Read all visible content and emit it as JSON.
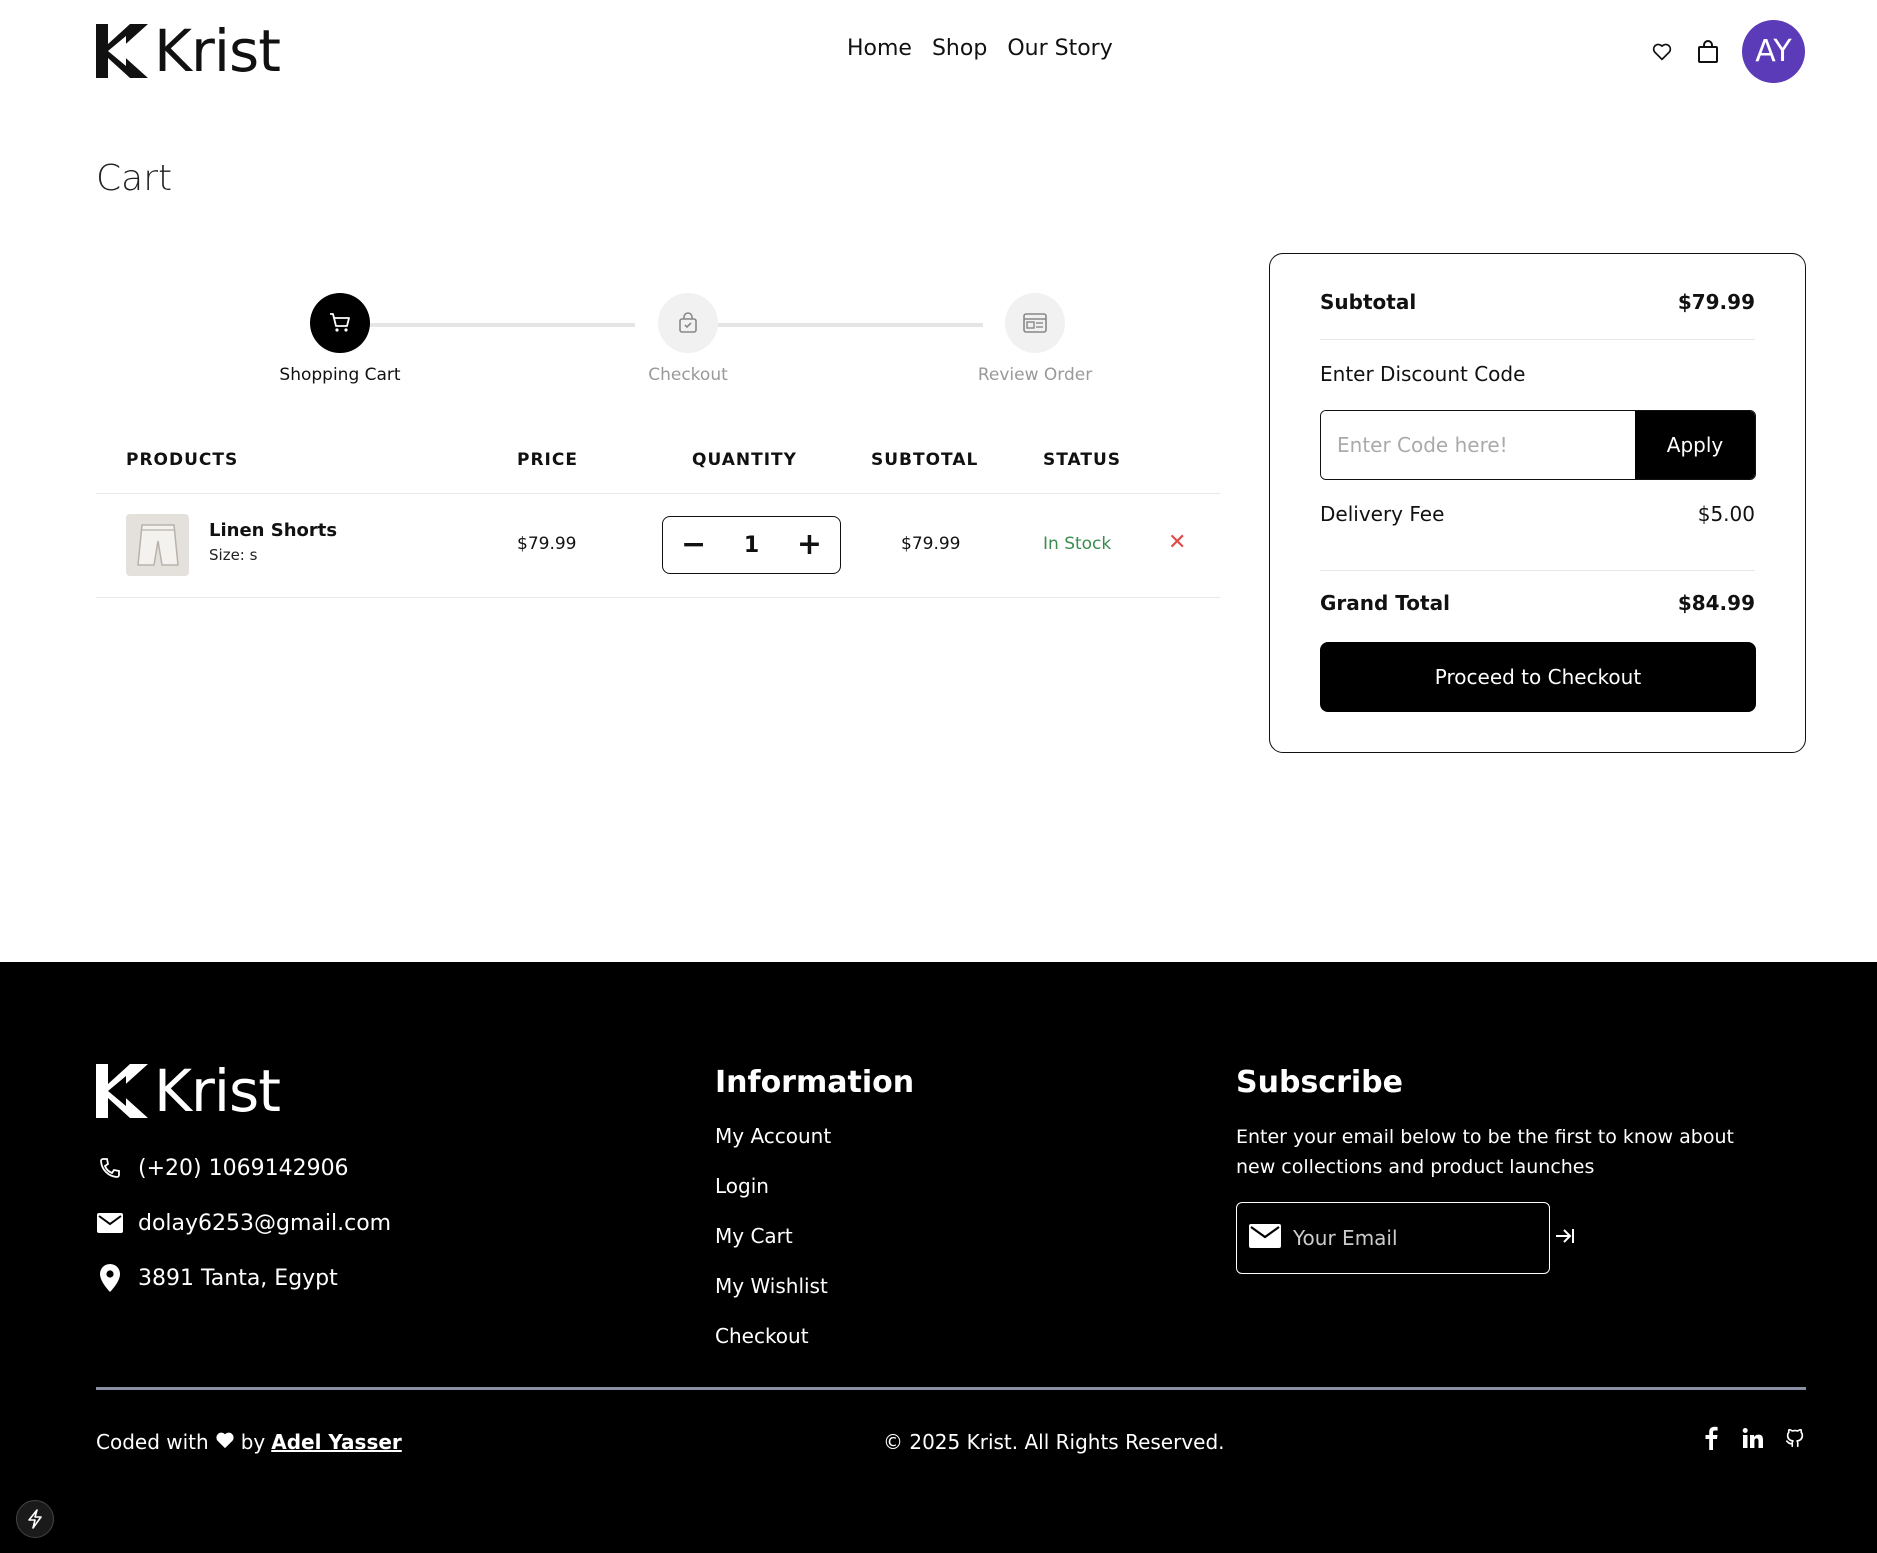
{
  "brand": {
    "name": "Krist"
  },
  "nav": {
    "items": [
      "Home",
      "Shop",
      "Our Story"
    ]
  },
  "user": {
    "initials": "AY"
  },
  "page": {
    "title": "Cart"
  },
  "stepper": {
    "steps": [
      "Shopping Cart",
      "Checkout",
      "Review Order"
    ],
    "active_index": 0
  },
  "cart_table": {
    "headers": [
      "PRODUCTS",
      "PRICE",
      "QUANTITY",
      "SUBTOTAL",
      "STATUS"
    ],
    "rows": [
      {
        "name": "Linen Shorts",
        "size": "Size: s",
        "price": "$79.99",
        "quantity": "1",
        "subtotal": "$79.99",
        "status": "In Stock"
      }
    ]
  },
  "summary": {
    "subtotal_label": "Subtotal",
    "subtotal_value": "$79.99",
    "discount_label": "Enter Discount Code",
    "discount_placeholder": "Enter Code here!",
    "apply_label": "Apply",
    "delivery_label": "Delivery Fee",
    "delivery_value": "$5.00",
    "grand_total_label": "Grand Total",
    "grand_total_value": "$84.99",
    "checkout_label": "Proceed to Checkout"
  },
  "footer": {
    "phone": "(+20) 1069142906",
    "email": "dolay6253@gmail.com",
    "address": "3891 Tanta, Egypt",
    "info_title": "Information",
    "info_links": [
      "My Account",
      "Login",
      "My Cart",
      "My Wishlist",
      "Checkout"
    ],
    "subscribe_title": "Subscribe",
    "subscribe_text": "Enter your email below to be the first to know about new collections and product launches",
    "email_placeholder": "Your Email",
    "coded_with": "Coded with",
    "by": "by",
    "author": "Adel Yasser",
    "copyright": "© 2025 Krist. All Rights Reserved."
  },
  "colors": {
    "accent_avatar": "#5b3bb8",
    "in_stock": "#3a8d4e",
    "remove": "#e24a4a"
  }
}
